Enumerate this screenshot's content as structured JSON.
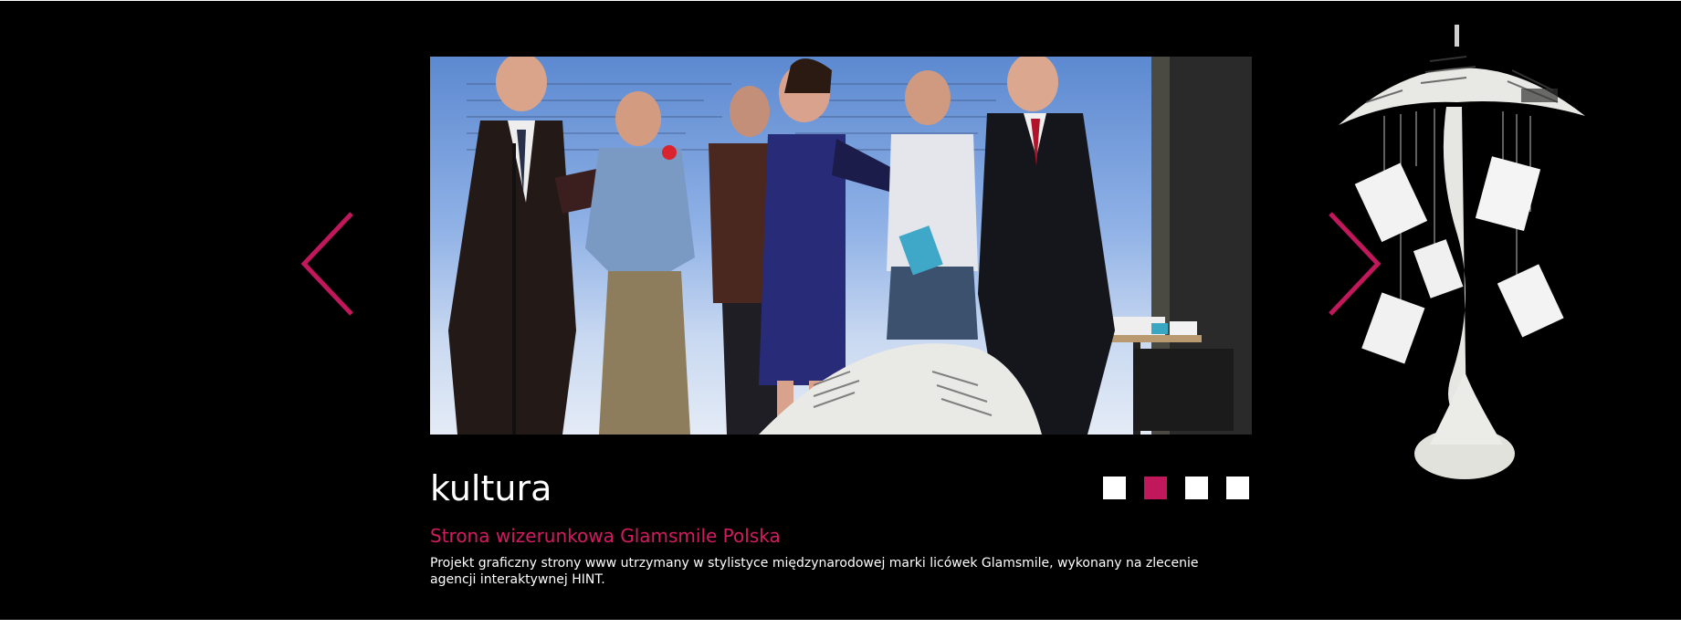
{
  "slide": {
    "title": "kultura",
    "subtitle": "Strona wizerunkowa Glamsmile Polska",
    "description": "Projekt graficzny strony www utrzymany w stylistyce międzynarodowej marki licówek Glamsmile, wykonany na zlecenie agencji interaktywnej HINT.",
    "photo": "award-ceremony-photo",
    "side_image": "paper-umbrella-sculpture"
  },
  "navigation": {
    "prev_icon": "chevron-left-icon",
    "next_icon": "chevron-right-icon",
    "accent_color": "#c0185a"
  },
  "pagination": {
    "total": 4,
    "active_index": 1
  },
  "colors": {
    "background": "#000000",
    "accent": "#c0185a",
    "text": "#ffffff"
  }
}
